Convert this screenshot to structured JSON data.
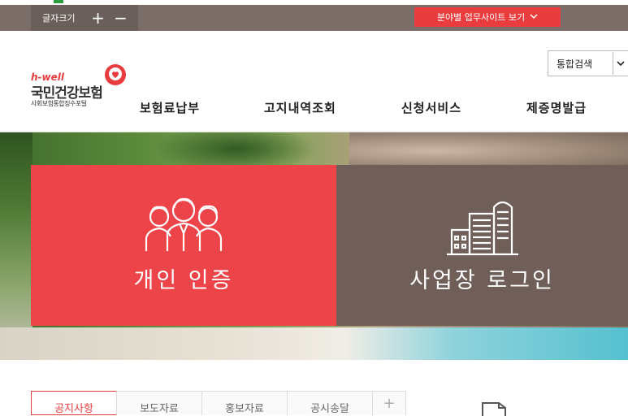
{
  "utility_bar": {
    "font_size_label": "글자크기",
    "increase_label": "+",
    "decrease_label": "−",
    "site_button_label": "분야별 업무사이트 보기",
    "site_button_icon": "chevron-down-icon"
  },
  "logo": {
    "brand": "h-well",
    "name": "국민건강보험",
    "subtitle": "사회보험통합징수포털"
  },
  "search": {
    "selected": "통합검색",
    "icon": "chevron-down-icon"
  },
  "nav": {
    "items": [
      {
        "label": "보험료납부"
      },
      {
        "label": "고지내역조회"
      },
      {
        "label": "신청서비스"
      },
      {
        "label": "제증명발급"
      }
    ]
  },
  "hero": {
    "personal_label": "개인 인증",
    "personal_icon": "people-icon",
    "business_label": "사업장 로그인",
    "business_icon": "building-icon"
  },
  "tabs": [
    {
      "label": "공지사항"
    },
    {
      "label": "보도자료"
    },
    {
      "label": "홍보자료"
    },
    {
      "label": "공시송달"
    },
    {
      "label": "+"
    }
  ],
  "colors": {
    "brand_red": "#e83c3f",
    "util_bar": "#7b6e68",
    "business_card": "#6f5f58"
  }
}
